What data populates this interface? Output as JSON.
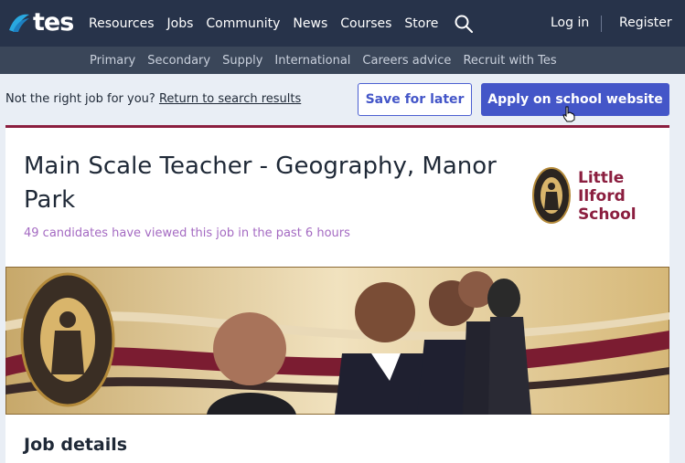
{
  "brand": {
    "logo_text": "tes"
  },
  "topnav": {
    "links": [
      "Resources",
      "Jobs",
      "Community",
      "News",
      "Courses",
      "Store"
    ],
    "login": "Log in",
    "register": "Register"
  },
  "subnav": {
    "links": [
      "Primary",
      "Secondary",
      "Supply",
      "International",
      "Careers advice",
      "Recruit with Tes"
    ]
  },
  "actionbar": {
    "prompt": "Not the right job for you?",
    "return_link": "Return to search results",
    "save_label": "Save for later",
    "apply_label": "Apply on school website"
  },
  "job": {
    "title": "Main Scale Teacher - Geography, Manor Park",
    "views_text": "49 candidates have viewed this job in the past 6 hours",
    "school_name_lines": [
      "Little",
      "Ilford",
      "School"
    ],
    "banner_badge_text": "LITTLE ILFORD SCHOOL",
    "details_heading": "Job details"
  },
  "colors": {
    "nav_bg": "#27334a",
    "subnav_bg": "#3a4659",
    "accent": "#4456c8",
    "school_maroon": "#8b1e3f",
    "views_text": "#a46ac2"
  }
}
